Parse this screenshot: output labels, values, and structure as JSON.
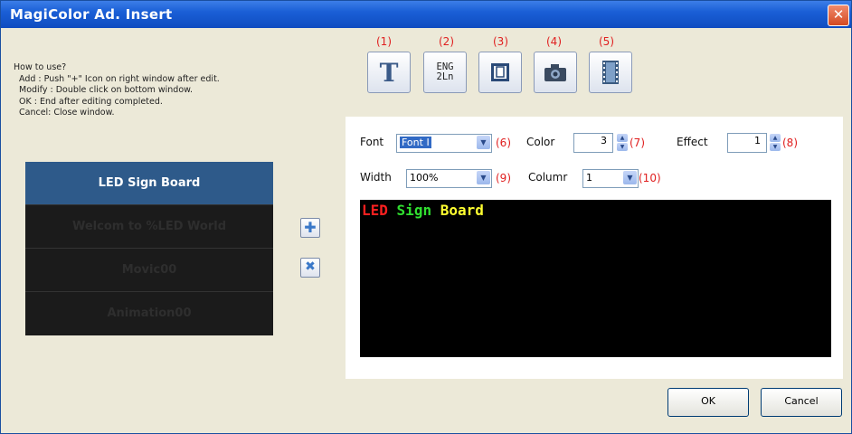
{
  "window": {
    "title": "MagiColor Ad. Insert",
    "close_glyph": "✕"
  },
  "help": {
    "heading": "How to use?",
    "lines": [
      "Add : Push \"+\" Icon on right window after edit.",
      "Modify : Double click on bottom window.",
      "OK : End after editing completed.",
      "Cancel: Close window."
    ]
  },
  "list": {
    "items": [
      {
        "label": "LED Sign Board",
        "selected": true
      },
      {
        "label": "Welcom to %LED World",
        "selected": false
      },
      {
        "label": "Movic00",
        "selected": false
      },
      {
        "label": "Animation00",
        "selected": false
      }
    ]
  },
  "side_buttons": {
    "add_glyph": "✚",
    "delete_glyph": "✖"
  },
  "toolbar": {
    "numbers": [
      "(1)",
      "(2)",
      "(3)",
      "(4)",
      "(5)"
    ],
    "text_glyph": "T",
    "eng_line1": "ENG",
    "eng_line2": "2Ln",
    "icons": [
      "text-icon",
      "two-line-english-icon",
      "frame-icon",
      "camera-icon",
      "film-icon"
    ]
  },
  "fields": {
    "font_label": "Font",
    "font_value": "Font I",
    "font_num": "(6)",
    "color_label": "Color",
    "color_value": "3",
    "color_num": "(7)",
    "effect_label": "Effect",
    "effect_value": "1",
    "effect_num": "(8)",
    "width_label": "Width",
    "width_value": "100%",
    "width_num": "(9)",
    "column_label": "Columr",
    "column_value": "1",
    "column_num": "(10)"
  },
  "preview": {
    "words": [
      {
        "text": "LED",
        "color": "#ff2020"
      },
      {
        "text": "Sign",
        "color": "#30e030"
      },
      {
        "text": "Board",
        "color": "#ffff30"
      }
    ]
  },
  "buttons": {
    "ok": "OK",
    "cancel": "Cancel"
  },
  "colors": {
    "accent": "#1a5fd6",
    "selected_item": "#2e5a8a",
    "annotation_red": "#e02020"
  }
}
